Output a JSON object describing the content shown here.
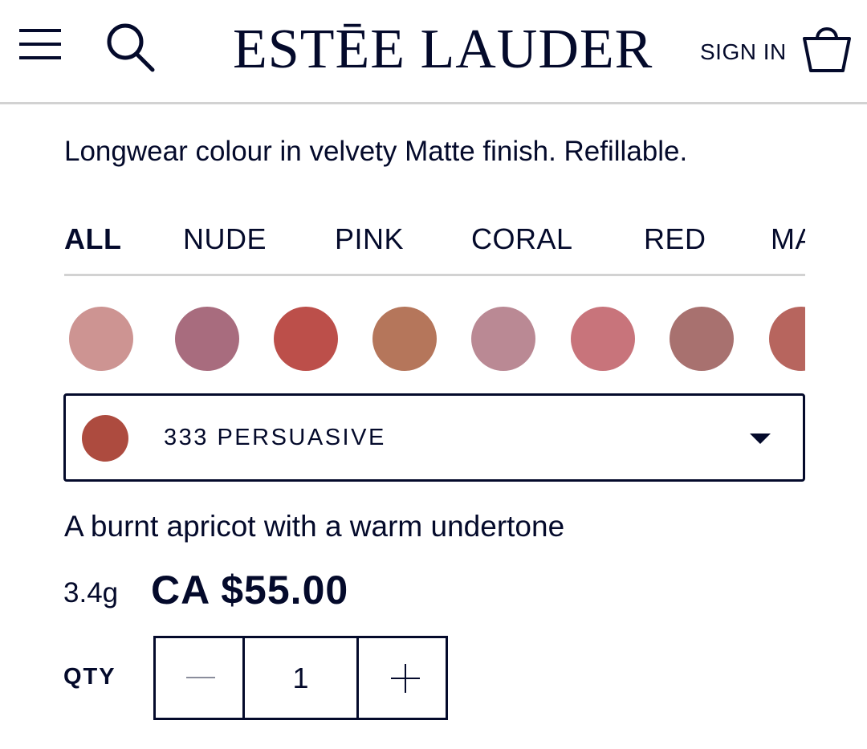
{
  "header": {
    "menu_icon": "hamburger-menu-icon",
    "search_icon": "search-icon",
    "brand": "ESTĒE LAUDER",
    "sign_in": "SIGN IN",
    "bag_icon": "shopping-bag-icon"
  },
  "product": {
    "tagline": "Longwear colour in velvety Matte finish. Refillable.",
    "shade_description": "A burnt apricot with a warm undertone",
    "size": "3.4g",
    "price": "CA $55.00"
  },
  "tabs": [
    {
      "label": "ALL",
      "active": true
    },
    {
      "label": "NUDE",
      "active": false
    },
    {
      "label": "PINK",
      "active": false
    },
    {
      "label": "CORAL",
      "active": false
    },
    {
      "label": "RED",
      "active": false
    },
    {
      "label": "MAUVE",
      "active": false
    }
  ],
  "swatches": [
    {
      "color": "#cd9492"
    },
    {
      "color": "#a86c7e"
    },
    {
      "color": "#bc4f4a"
    },
    {
      "color": "#b5765b"
    },
    {
      "color": "#ba8994"
    },
    {
      "color": "#c8747b"
    },
    {
      "color": "#a8716f"
    },
    {
      "color": "#b7655e"
    }
  ],
  "shade_select": {
    "selected_label": "333 PERSUASIVE",
    "selected_color": "#ad4b3f",
    "caret_icon": "caret-down-icon"
  },
  "quantity": {
    "label": "QTY",
    "value": "1",
    "minus_icon": "minus-icon",
    "plus_icon": "plus-icon"
  },
  "colors": {
    "text": "#040a2b",
    "divider": "#d2d2d2"
  }
}
